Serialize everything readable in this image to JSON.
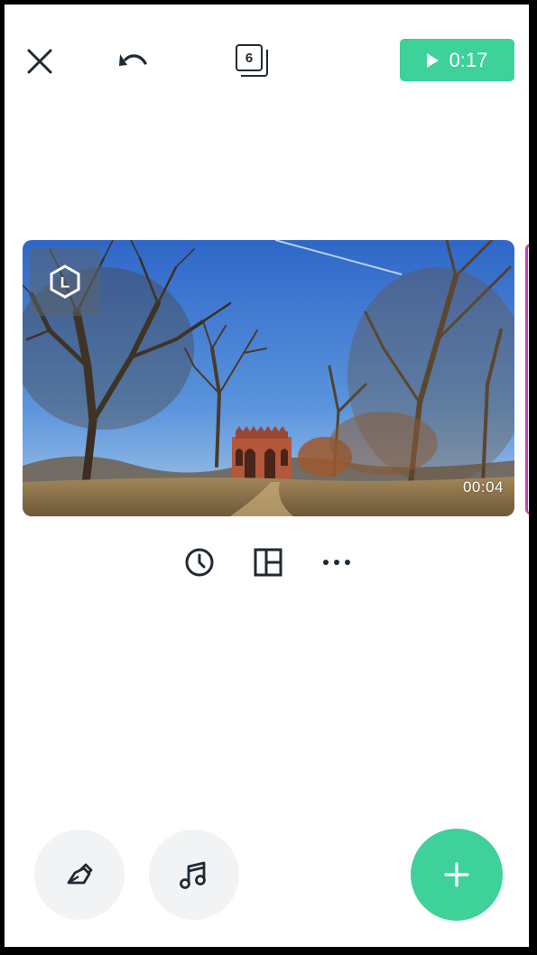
{
  "toolbar": {
    "close_icon": "close-icon",
    "undo_icon": "undo-icon",
    "clip_count": "6",
    "play_icon": "play-icon",
    "play_duration": "0:17"
  },
  "clip": {
    "badge_letter": "L",
    "duration": "00:04",
    "image_description_icon": "photo-thumbnail"
  },
  "clip_tools": {
    "timer_icon": "clock-icon",
    "layout_icon": "layout-icon",
    "more_icon": "more-icon"
  },
  "bottom_actions": {
    "pen_icon": "pen-icon",
    "music_icon": "music-icon",
    "add_icon": "plus-icon"
  },
  "colors": {
    "accent": "#3fd19a",
    "next_clip_accent": "#c63fb5",
    "icon_dark": "#1f2a33"
  }
}
